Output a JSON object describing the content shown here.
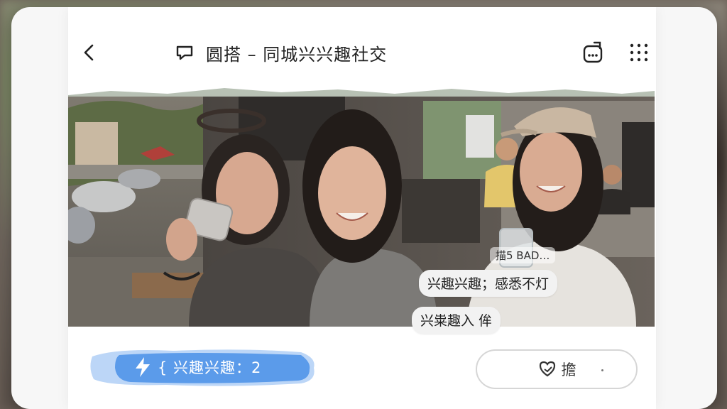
{
  "app": {
    "title": "圆搭 – 同城兴兴趣社交"
  },
  "icons": {
    "back": "chevron-left-icon",
    "title": "chat-bubble-icon",
    "share": "share-icon",
    "grid": "grid-menu-icon",
    "bolt": "lightning-icon",
    "react": "heart-hand-icon"
  },
  "photo": {
    "overlay_small": "描5 BAD…",
    "caption_1": "兴趣兴趣；感悉不灯",
    "caption_2": "兴粜趣入 侔"
  },
  "actions": {
    "join_label": "{ 兴趣兴趣：2",
    "secondary_label": "擔"
  },
  "colors": {
    "accent_blue": "#5b9bea",
    "card_bg": "#ffffff",
    "text_dark": "#222222"
  }
}
